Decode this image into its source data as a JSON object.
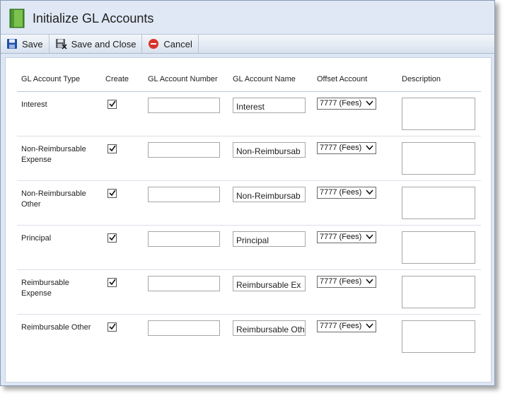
{
  "window": {
    "title": "Initialize GL Accounts"
  },
  "toolbar": {
    "save_label": "Save",
    "save_close_label": "Save and Close",
    "cancel_label": "Cancel"
  },
  "table": {
    "headers": {
      "type": "GL Account Type",
      "create": "Create",
      "number": "GL Account Number",
      "name": "GL Account Name",
      "offset": "Offset Account",
      "description": "Description"
    },
    "rows": [
      {
        "type_line1": "Interest",
        "type_line2": "",
        "create": true,
        "number": "",
        "name": "Interest",
        "offset": "7777 (Fees)",
        "description": ""
      },
      {
        "type_line1": "Non-Reimbursable",
        "type_line2": "Expense",
        "create": true,
        "number": "",
        "name": "Non-Reimbursab",
        "offset": "7777 (Fees)",
        "description": ""
      },
      {
        "type_line1": "Non-Reimbursable",
        "type_line2": "Other",
        "create": true,
        "number": "",
        "name": "Non-Reimbursab",
        "offset": "7777 (Fees)",
        "description": ""
      },
      {
        "type_line1": "Principal",
        "type_line2": "",
        "create": true,
        "number": "",
        "name": "Principal",
        "offset": "7777 (Fees)",
        "description": ""
      },
      {
        "type_line1": "Reimbursable",
        "type_line2": "Expense",
        "create": true,
        "number": "",
        "name": "Reimbursable Ex",
        "offset": "7777 (Fees)",
        "description": ""
      },
      {
        "type_line1": "Reimbursable Other",
        "type_line2": "",
        "create": true,
        "number": "",
        "name": "Reimbursable Oth",
        "offset": "7777 (Fees)",
        "description": ""
      }
    ]
  },
  "icons": {
    "app": "book-icon",
    "save": "floppy-disk-icon",
    "save_close": "floppy-disk-close-icon",
    "cancel": "cancel-circle-icon",
    "check": "check-icon",
    "dropdown": "chevron-down-icon"
  },
  "colors": {
    "titlebar": "#dfe8f4",
    "toolbar": "#d7e1ee",
    "cancel_red": "#d9332b",
    "save_blue": "#1f4fa8",
    "book_green": "#5aa83a"
  }
}
